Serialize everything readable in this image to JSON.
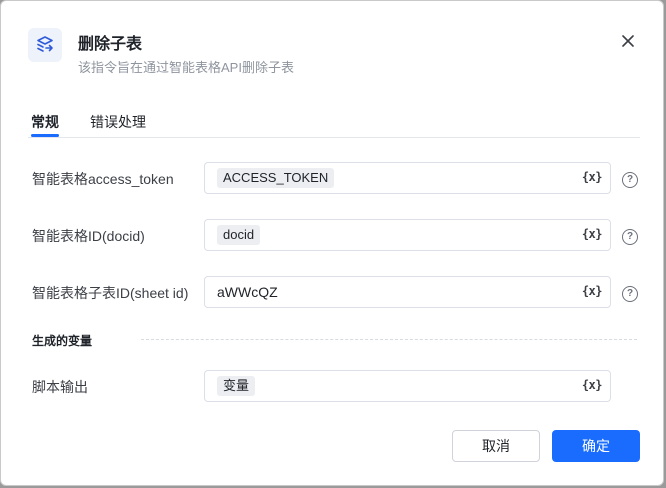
{
  "header": {
    "icon": "table-delete-icon",
    "title": "删除子表",
    "subtitle": "该指令旨在通过智能表格API删除子表"
  },
  "tabs": [
    {
      "label": "常规",
      "active": true
    },
    {
      "label": "错误处理",
      "active": false
    }
  ],
  "fields": {
    "access_token": {
      "label": "智能表格access_token",
      "value": "ACCESS_TOKEN"
    },
    "docid": {
      "label": "智能表格ID(docid)",
      "value": "docid"
    },
    "sheet_id": {
      "label": "智能表格子表ID(sheet id)",
      "value": "aWWcQZ"
    }
  },
  "var_icon_text": "{x}",
  "help_icon_text": "?",
  "output_section": {
    "title": "生成的变量",
    "script_output": {
      "label": "脚本输出",
      "value": "变量"
    }
  },
  "footer": {
    "cancel_label": "取消",
    "confirm_label": "确定"
  },
  "colors": {
    "accent": "#1a6cff"
  }
}
